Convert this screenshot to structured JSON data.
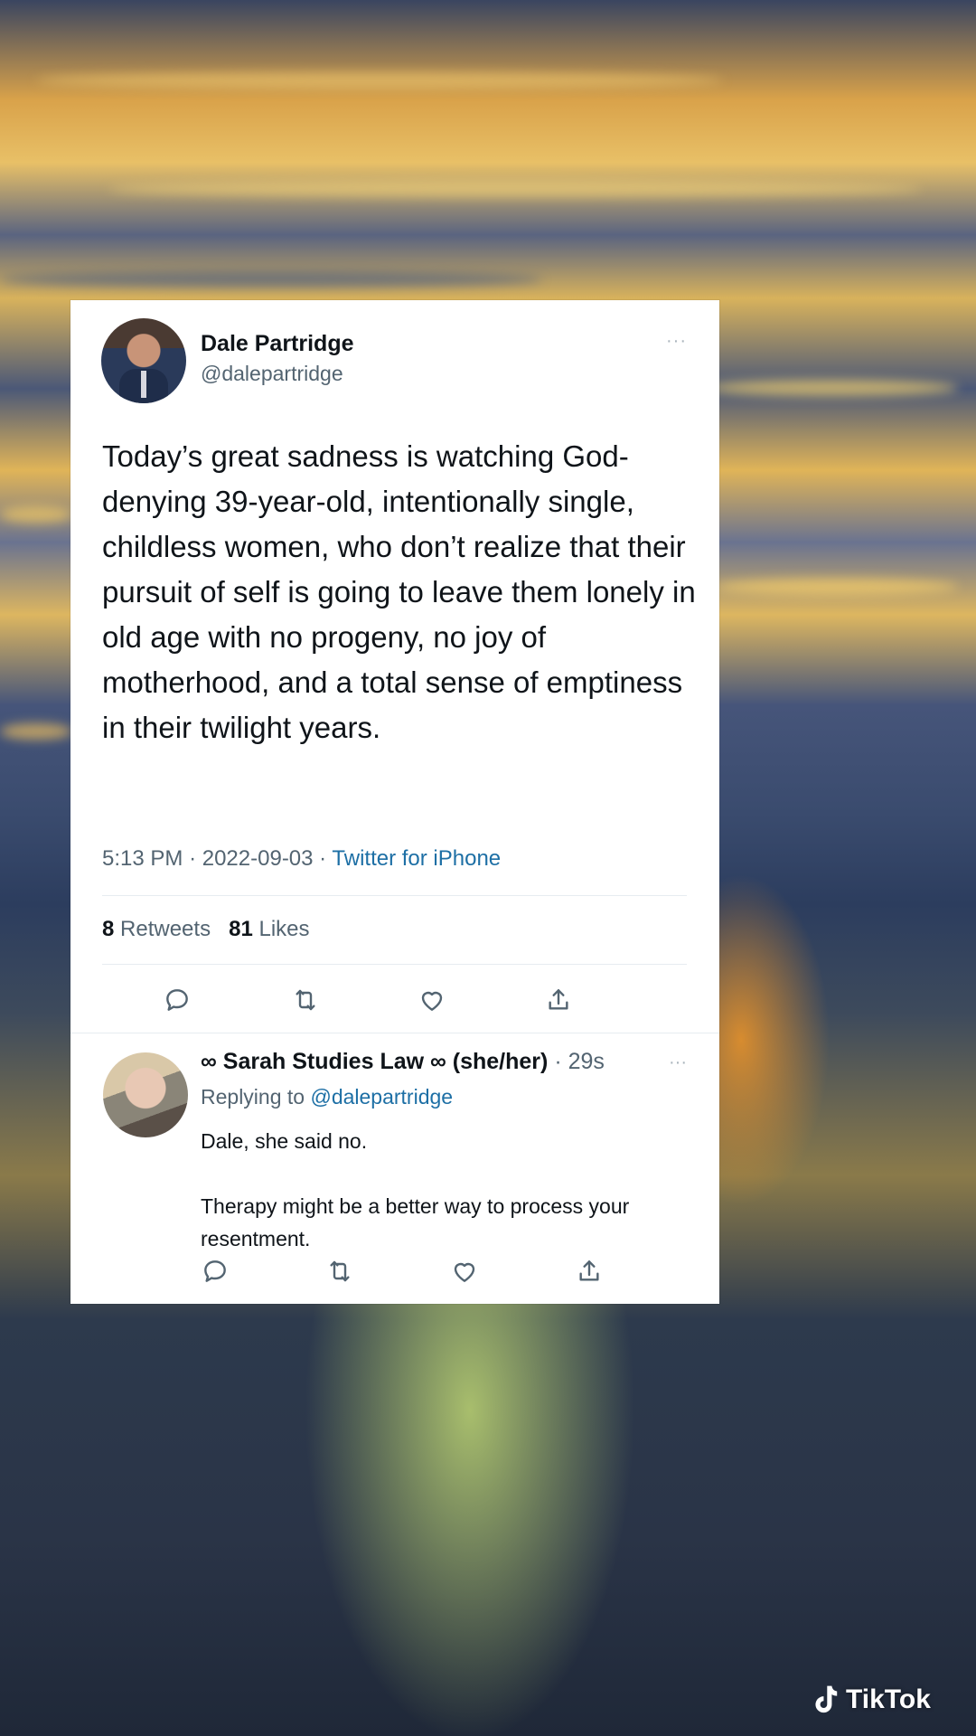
{
  "tweet": {
    "display_name": "Dale Partridge",
    "handle": "@dalepartridge",
    "more": "···",
    "text": "Today’s great sadness is watching God-denying 39-year-old, intentionally single, childless women, who don’t realize that their pursuit of self is going to leave them lonely in old age with no progeny, no joy of motherhood, and a total sense of emptiness in their twilight years.",
    "time": "5:13 PM",
    "date": "2022-09-03",
    "source": "Twitter for iPhone",
    "retweets_count": "8",
    "retweets_label": "Retweets",
    "likes_count": "81",
    "likes_label": "Likes"
  },
  "reply": {
    "display_name": "∞ Sarah Studies Law ∞ (she/her)",
    "time": "· 29s",
    "more": "···",
    "replying_prefix": "Replying to",
    "replying_to": "@dalepartridge",
    "line1": "Dale, she said no.",
    "line2": "Therapy might be a better way to process your resentment."
  },
  "watermark": {
    "label": "TikTok"
  },
  "icons": [
    "reply-icon",
    "retweet-icon",
    "like-icon",
    "share-icon",
    "tiktok-logo-icon"
  ],
  "colors": {
    "text": "#0f1419",
    "secondary": "#536471",
    "link": "#1d6fa5"
  }
}
